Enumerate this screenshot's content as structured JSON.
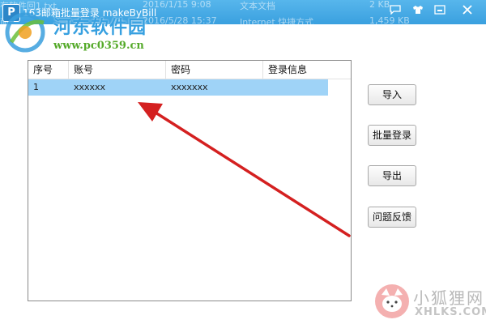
{
  "window": {
    "title": "163邮箱批量登录 makeByBill",
    "icon_letter": "P",
    "controls": [
      "menu-icon",
      "skin-icon",
      "minimize-icon",
      "close-icon"
    ]
  },
  "background_rows": [
    {
      "name": "有软件回1.txt",
      "date": "2016/1/15 9:08",
      "type": "文本文档",
      "size": "2 KB"
    },
    {
      "name": "面",
      "date": "2016/5/28 15:37",
      "type": "Internet 快捷方式",
      "size": "1,459 KB"
    }
  ],
  "watermark": {
    "site_name": "河东软件园",
    "site_url": "www.pc0359.cn",
    "corner_name": "小狐狸网",
    "corner_url": "XHLKS.COM"
  },
  "table": {
    "columns": [
      "序号",
      "账号",
      "密码",
      "登录信息"
    ],
    "rows": [
      {
        "index": "1",
        "account": "xxxxxx",
        "password": "xxxxxxx",
        "info": ""
      }
    ]
  },
  "buttons": {
    "import": "导入",
    "batch_login": "批量登录",
    "export": "导出",
    "feedback": "问题反馈"
  },
  "colors": {
    "titlebar": "#3aa0df",
    "selected_row": "#9fd3f7",
    "arrow": "#d42020"
  }
}
